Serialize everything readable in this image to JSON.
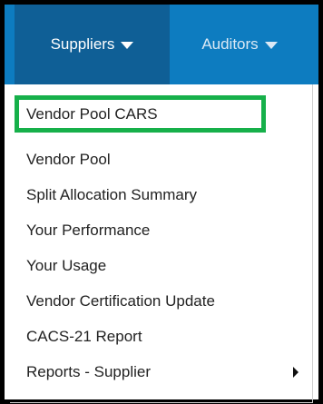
{
  "navbar": {
    "tabs": [
      {
        "label": "Suppliers",
        "active": true
      },
      {
        "label": "Auditors",
        "active": false
      }
    ],
    "color": "#0d7cc0",
    "active_color": "#0f5f96"
  },
  "dropdown": {
    "highlight_color": "#16b04a",
    "items": [
      {
        "label": "Vendor Pool CARS",
        "highlighted": true
      },
      {
        "label": "Vendor Pool"
      },
      {
        "label": "Split Allocation Summary"
      },
      {
        "label": "Your Performance"
      },
      {
        "label": "Your Usage"
      },
      {
        "label": "Vendor Certification Update"
      },
      {
        "label": "CACS-21 Report"
      },
      {
        "label": "Reports - Supplier",
        "has_submenu": true
      }
    ]
  }
}
